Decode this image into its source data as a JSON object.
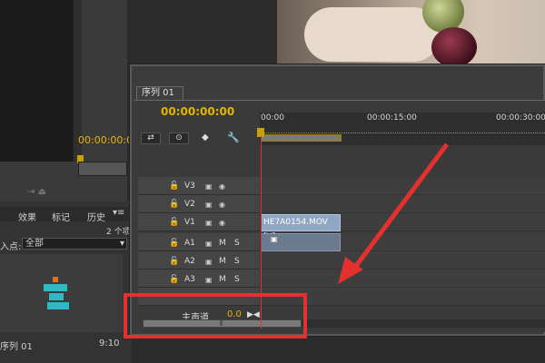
{
  "source_monitor": {
    "timecode": "00:00:00:0"
  },
  "project_panel": {
    "tabs": [
      "效果",
      "标记",
      "历史"
    ],
    "count": "2 个项",
    "inpoint_label": "入点:",
    "inpoint_value": "全部",
    "item": {
      "name": "序列 01",
      "duration": "9:10"
    }
  },
  "timeline": {
    "tab_label": "序列 01",
    "timecode": "00:00:00:00",
    "ruler_labels": [
      "00:00",
      "00:00:15:00",
      "00:00:30:00"
    ],
    "tracks": [
      {
        "name": "V3",
        "type": "video"
      },
      {
        "name": "V2",
        "type": "video"
      },
      {
        "name": "V1",
        "type": "video"
      },
      {
        "name": "A1",
        "type": "audio"
      },
      {
        "name": "A2",
        "type": "audio"
      },
      {
        "name": "A3",
        "type": "audio"
      }
    ],
    "clip_v1": "HE7A0154.MOV [V]",
    "master_label": "主声道",
    "master_value": "0.0",
    "icons": {
      "lock": "lock-icon",
      "eye": "eye-icon",
      "film": "film-icon",
      "mute": "M",
      "solo": "S"
    }
  },
  "colors": {
    "accent": "#e5b500",
    "playhead": "#d63a2c",
    "annotation": "#e53030",
    "clip_video": "#8fa6c4"
  }
}
